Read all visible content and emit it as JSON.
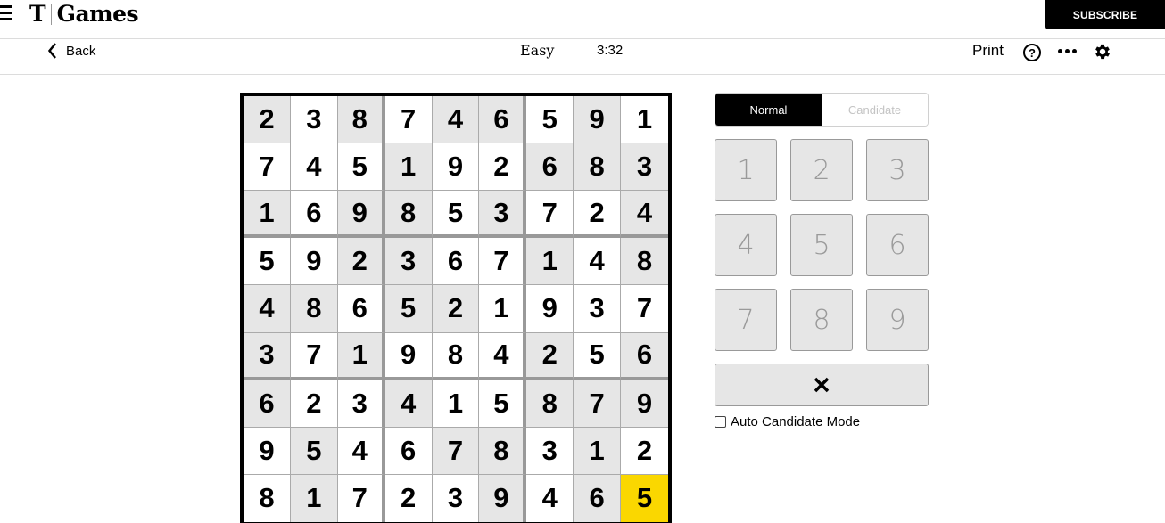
{
  "header": {
    "logo_mark": "T",
    "logo_text": "Games",
    "subscribe_label": "SUBSCRIBE"
  },
  "toolbar": {
    "back_label": "Back",
    "difficulty": "Easy",
    "timer": "3:32",
    "print_label": "Print",
    "help_icon": "?",
    "icons": [
      "hamburger-menu-icon",
      "chevron-left-icon",
      "help-circle-icon",
      "more-dots-icon",
      "gear-icon"
    ]
  },
  "board": {
    "rows": [
      [
        2,
        3,
        8,
        7,
        4,
        6,
        5,
        9,
        1
      ],
      [
        7,
        4,
        5,
        1,
        9,
        2,
        6,
        8,
        3
      ],
      [
        1,
        6,
        9,
        8,
        5,
        3,
        7,
        2,
        4
      ],
      [
        5,
        9,
        2,
        3,
        6,
        7,
        1,
        4,
        8
      ],
      [
        4,
        8,
        6,
        5,
        2,
        1,
        9,
        3,
        7
      ],
      [
        3,
        7,
        1,
        9,
        8,
        4,
        2,
        5,
        6
      ],
      [
        6,
        2,
        3,
        4,
        1,
        5,
        8,
        7,
        9
      ],
      [
        9,
        5,
        4,
        6,
        7,
        8,
        3,
        1,
        2
      ],
      [
        8,
        1,
        7,
        2,
        3,
        9,
        4,
        6,
        5
      ]
    ],
    "prefilled_mask": [
      "gwgwggwgw",
      "wwwgwwggg",
      "gwggwgwwg",
      "wwgggwwgwg",
      "gggggwwwww",
      "gwgwwwgwg",
      "gwwgwwggg",
      "wgwwggwgw",
      "wgwwwgwgy"
    ],
    "selected_cell": {
      "row": 9,
      "col": 9
    },
    "colors": {
      "prefilled": "#e6e6e6",
      "empty": "#ffffff",
      "selected": "#fad700"
    }
  },
  "panel": {
    "modes": [
      {
        "label": "Normal",
        "active": true
      },
      {
        "label": "Candidate",
        "active": false
      }
    ],
    "keys": [
      "1",
      "2",
      "3",
      "4",
      "5",
      "6",
      "7",
      "8",
      "9"
    ],
    "erase_icon": "close-x-icon",
    "auto_candidate_label": "Auto Candidate Mode",
    "auto_candidate_checked": false
  }
}
